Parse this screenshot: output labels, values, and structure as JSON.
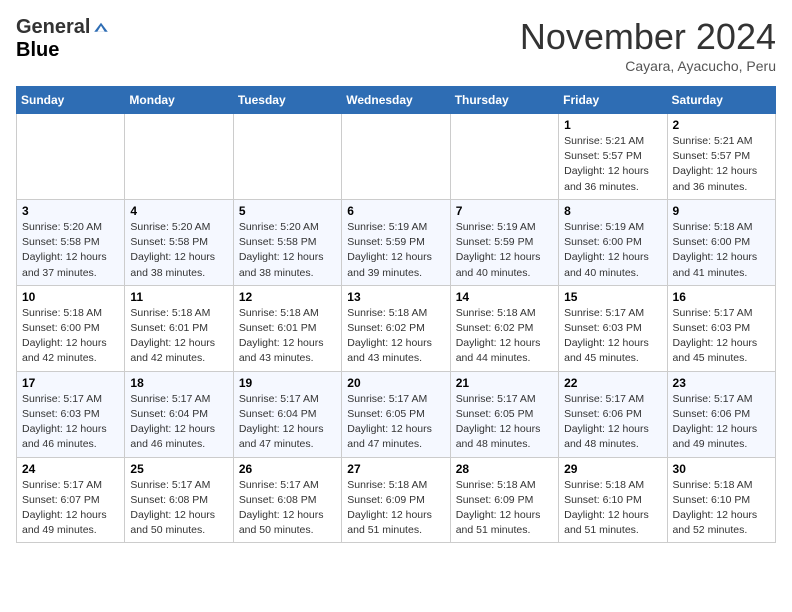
{
  "header": {
    "logo_general": "General",
    "logo_blue": "Blue",
    "month_title": "November 2024",
    "subtitle": "Cayara, Ayacucho, Peru"
  },
  "calendar": {
    "days_of_week": [
      "Sunday",
      "Monday",
      "Tuesday",
      "Wednesday",
      "Thursday",
      "Friday",
      "Saturday"
    ],
    "weeks": [
      [
        {
          "day": "",
          "info": ""
        },
        {
          "day": "",
          "info": ""
        },
        {
          "day": "",
          "info": ""
        },
        {
          "day": "",
          "info": ""
        },
        {
          "day": "",
          "info": ""
        },
        {
          "day": "1",
          "info": "Sunrise: 5:21 AM\nSunset: 5:57 PM\nDaylight: 12 hours\nand 36 minutes."
        },
        {
          "day": "2",
          "info": "Sunrise: 5:21 AM\nSunset: 5:57 PM\nDaylight: 12 hours\nand 36 minutes."
        }
      ],
      [
        {
          "day": "3",
          "info": "Sunrise: 5:20 AM\nSunset: 5:58 PM\nDaylight: 12 hours\nand 37 minutes."
        },
        {
          "day": "4",
          "info": "Sunrise: 5:20 AM\nSunset: 5:58 PM\nDaylight: 12 hours\nand 38 minutes."
        },
        {
          "day": "5",
          "info": "Sunrise: 5:20 AM\nSunset: 5:58 PM\nDaylight: 12 hours\nand 38 minutes."
        },
        {
          "day": "6",
          "info": "Sunrise: 5:19 AM\nSunset: 5:59 PM\nDaylight: 12 hours\nand 39 minutes."
        },
        {
          "day": "7",
          "info": "Sunrise: 5:19 AM\nSunset: 5:59 PM\nDaylight: 12 hours\nand 40 minutes."
        },
        {
          "day": "8",
          "info": "Sunrise: 5:19 AM\nSunset: 6:00 PM\nDaylight: 12 hours\nand 40 minutes."
        },
        {
          "day": "9",
          "info": "Sunrise: 5:18 AM\nSunset: 6:00 PM\nDaylight: 12 hours\nand 41 minutes."
        }
      ],
      [
        {
          "day": "10",
          "info": "Sunrise: 5:18 AM\nSunset: 6:00 PM\nDaylight: 12 hours\nand 42 minutes."
        },
        {
          "day": "11",
          "info": "Sunrise: 5:18 AM\nSunset: 6:01 PM\nDaylight: 12 hours\nand 42 minutes."
        },
        {
          "day": "12",
          "info": "Sunrise: 5:18 AM\nSunset: 6:01 PM\nDaylight: 12 hours\nand 43 minutes."
        },
        {
          "day": "13",
          "info": "Sunrise: 5:18 AM\nSunset: 6:02 PM\nDaylight: 12 hours\nand 43 minutes."
        },
        {
          "day": "14",
          "info": "Sunrise: 5:18 AM\nSunset: 6:02 PM\nDaylight: 12 hours\nand 44 minutes."
        },
        {
          "day": "15",
          "info": "Sunrise: 5:17 AM\nSunset: 6:03 PM\nDaylight: 12 hours\nand 45 minutes."
        },
        {
          "day": "16",
          "info": "Sunrise: 5:17 AM\nSunset: 6:03 PM\nDaylight: 12 hours\nand 45 minutes."
        }
      ],
      [
        {
          "day": "17",
          "info": "Sunrise: 5:17 AM\nSunset: 6:03 PM\nDaylight: 12 hours\nand 46 minutes."
        },
        {
          "day": "18",
          "info": "Sunrise: 5:17 AM\nSunset: 6:04 PM\nDaylight: 12 hours\nand 46 minutes."
        },
        {
          "day": "19",
          "info": "Sunrise: 5:17 AM\nSunset: 6:04 PM\nDaylight: 12 hours\nand 47 minutes."
        },
        {
          "day": "20",
          "info": "Sunrise: 5:17 AM\nSunset: 6:05 PM\nDaylight: 12 hours\nand 47 minutes."
        },
        {
          "day": "21",
          "info": "Sunrise: 5:17 AM\nSunset: 6:05 PM\nDaylight: 12 hours\nand 48 minutes."
        },
        {
          "day": "22",
          "info": "Sunrise: 5:17 AM\nSunset: 6:06 PM\nDaylight: 12 hours\nand 48 minutes."
        },
        {
          "day": "23",
          "info": "Sunrise: 5:17 AM\nSunset: 6:06 PM\nDaylight: 12 hours\nand 49 minutes."
        }
      ],
      [
        {
          "day": "24",
          "info": "Sunrise: 5:17 AM\nSunset: 6:07 PM\nDaylight: 12 hours\nand 49 minutes."
        },
        {
          "day": "25",
          "info": "Sunrise: 5:17 AM\nSunset: 6:08 PM\nDaylight: 12 hours\nand 50 minutes."
        },
        {
          "day": "26",
          "info": "Sunrise: 5:17 AM\nSunset: 6:08 PM\nDaylight: 12 hours\nand 50 minutes."
        },
        {
          "day": "27",
          "info": "Sunrise: 5:18 AM\nSunset: 6:09 PM\nDaylight: 12 hours\nand 51 minutes."
        },
        {
          "day": "28",
          "info": "Sunrise: 5:18 AM\nSunset: 6:09 PM\nDaylight: 12 hours\nand 51 minutes."
        },
        {
          "day": "29",
          "info": "Sunrise: 5:18 AM\nSunset: 6:10 PM\nDaylight: 12 hours\nand 51 minutes."
        },
        {
          "day": "30",
          "info": "Sunrise: 5:18 AM\nSunset: 6:10 PM\nDaylight: 12 hours\nand 52 minutes."
        }
      ]
    ]
  }
}
